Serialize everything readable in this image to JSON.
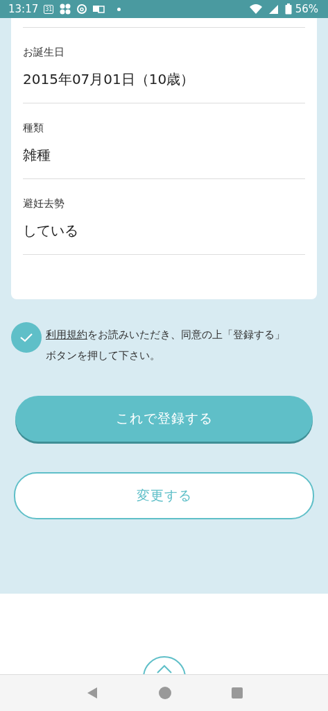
{
  "status_bar": {
    "time": "13:17",
    "calendar_day": "31",
    "battery": "56%"
  },
  "fields": [
    {
      "label": "お誕生日",
      "value": "2015年07月01日（10歳）"
    },
    {
      "label": "種類",
      "value": "雑種"
    },
    {
      "label": "避妊去勢",
      "value": "している"
    }
  ],
  "agreement": {
    "checked": true,
    "link": "利用規約",
    "text": "をお読みいただき、同意の上「登録する」ボタンを押して下さい。"
  },
  "buttons": [
    {
      "kind": "primary",
      "label": "これで登録する"
    },
    {
      "kind": "secondary",
      "label": "変更する"
    }
  ]
}
